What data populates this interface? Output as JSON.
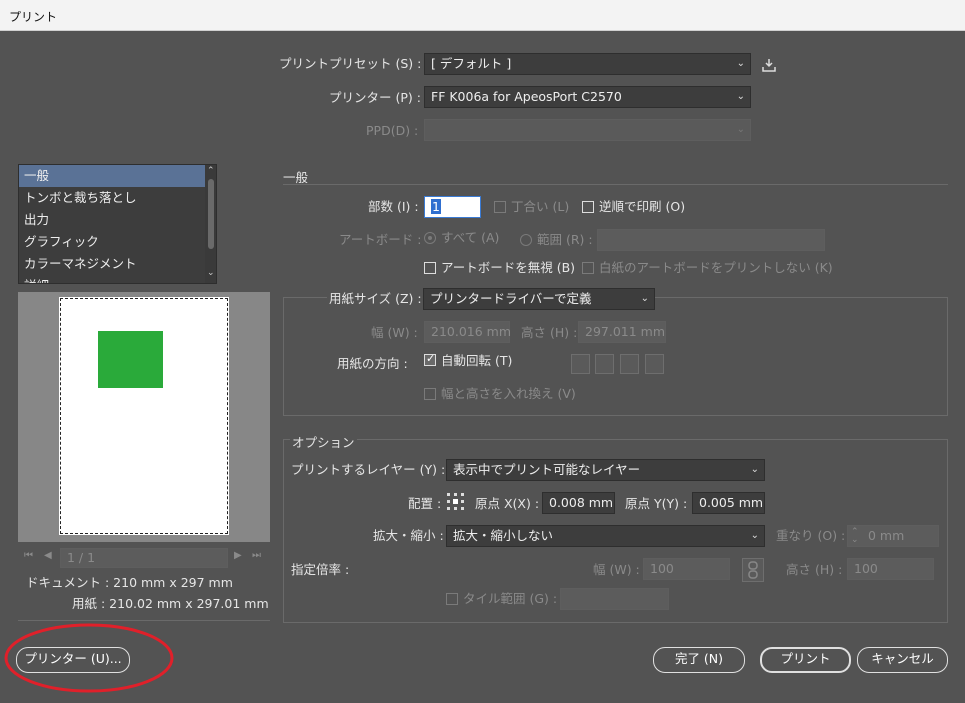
{
  "window": {
    "title": "プリント"
  },
  "header": {
    "preset_label": "プリントプリセット (S) :",
    "preset_value": "[ デフォルト ]",
    "printer_label": "プリンター (P) :",
    "printer_value": "FF K006a for ApeosPort C2570",
    "ppd_label": "PPD(D) :",
    "ppd_value": ""
  },
  "sidebar": {
    "items": [
      {
        "label": "一般"
      },
      {
        "label": "トンボと裁ち落とし"
      },
      {
        "label": "出力"
      },
      {
        "label": "グラフィック"
      },
      {
        "label": "カラーマネジメント"
      },
      {
        "label": "詳細"
      }
    ],
    "page_indicator": "1 / 1",
    "document_label": "ドキュメント : 210 mm x 297 mm",
    "paper_label": "用紙 : 210.02 mm x 297.01 mm",
    "preview_fill_color": "#2aaa3a"
  },
  "general": {
    "section_title": "一般",
    "copies_label": "部数 (I) :",
    "copies_value": "1",
    "collate_label": "丁合い (L)",
    "reverse_label": "逆順で印刷 (O)",
    "artboard_label": "アートボード :",
    "all_label": "すべて (A)",
    "range_label": "範囲 (R) :",
    "ignore_artboards_label": "アートボードを無視 (B)",
    "skip_blank_label": "白紙のアートボードをプリントしない (K)"
  },
  "paper": {
    "size_label": "用紙サイズ (Z) :",
    "size_value": "プリンタードライバーで定義",
    "width_label": "幅 (W) :",
    "width_value": "210.016 mm",
    "height_label": "高さ (H) :",
    "height_value": "297.011 mm",
    "orientation_label": "用紙の方向 :",
    "auto_rotate_label": "自動回転 (T)",
    "swap_label": "幅と高さを入れ換え (V)"
  },
  "options": {
    "section_title": "オプション",
    "layers_label": "プリントするレイヤー (Y) :",
    "layers_value": "表示中でプリント可能なレイヤー",
    "placement_label": "配置 :",
    "origin_x_label": "原点 X(X) :",
    "origin_x_value": "0.008 mm",
    "origin_y_label": "原点 Y(Y) :",
    "origin_y_value": "0.005 mm",
    "scale_label": "拡大・縮小 :",
    "scale_value": "拡大・縮小しない",
    "overlap_label": "重なり (O) :",
    "overlap_value": "0 mm",
    "custom_scale_label": "指定倍率 :",
    "scale_width_label": "幅 (W) :",
    "scale_width_value": "100",
    "scale_height_label": "高さ (H) :",
    "scale_height_value": "100",
    "tile_label": "タイル範囲 (G) :"
  },
  "footer": {
    "printer_button": "プリンター (U)...",
    "done_button": "完了 (N)",
    "print_button": "プリント",
    "cancel_button": "キャンセル",
    "annotation_color": "#e0202a"
  }
}
